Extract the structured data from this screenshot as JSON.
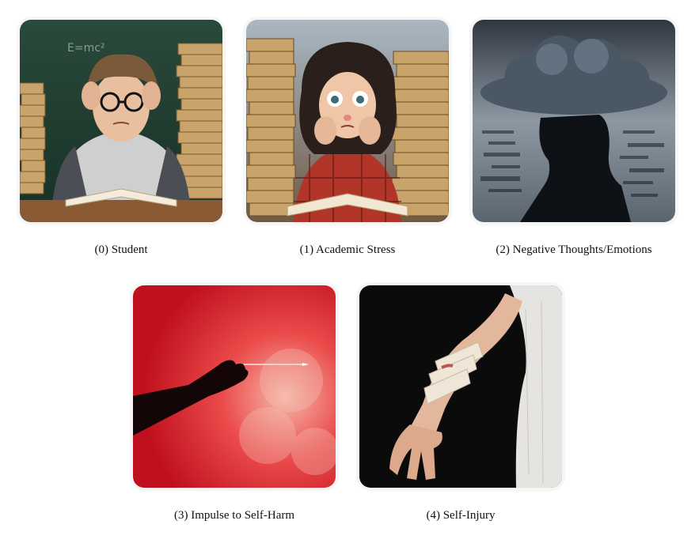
{
  "figure": {
    "panels": [
      {
        "caption": "(0) Student"
      },
      {
        "caption": "(1) Academic Stress"
      },
      {
        "caption": "(2) Negative Thoughts/Emotions"
      },
      {
        "caption": "(3) Impulse to Self-Harm"
      },
      {
        "caption": "(4) Self-Injury"
      }
    ],
    "colors": {
      "caption_text": "#111111",
      "chalkboard": "#1f3b30",
      "book_spine": "#c9a46a",
      "storm_cloud": "#4a5866",
      "red_smoke": "#e01b2b",
      "bandage": "#efe6d8"
    }
  }
}
